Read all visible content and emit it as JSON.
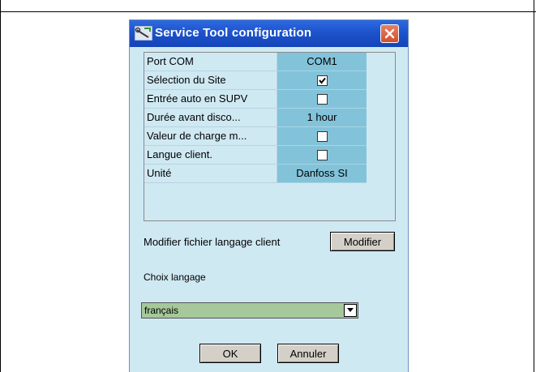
{
  "dialog": {
    "title": "Service Tool configuration",
    "title_icon": "wrench-tool-icon",
    "close_icon": "close-icon"
  },
  "settings": [
    {
      "name": "Port COM",
      "type": "text",
      "value": "COM1"
    },
    {
      "name": "Sélection du Site",
      "type": "checkbox",
      "checked": true
    },
    {
      "name": "Entrée auto en SUPV",
      "type": "checkbox",
      "checked": false
    },
    {
      "name": "Durée avant disco...",
      "type": "text",
      "value": "1 hour"
    },
    {
      "name": "Valeur de charge m...",
      "type": "checkbox",
      "checked": false
    },
    {
      "name": "Langue client.",
      "type": "checkbox",
      "checked": false
    },
    {
      "name": "Unité",
      "type": "text",
      "value": "Danfoss SI"
    }
  ],
  "modify": {
    "label": "Modifier fichier langage client",
    "button": "Modifier"
  },
  "language": {
    "label": "Choix langage",
    "selected": "français",
    "arrow_icon": "chevron-down-icon"
  },
  "buttons": {
    "ok": "OK",
    "cancel": "Annuler"
  },
  "colors": {
    "titlebar": "#1d53cc",
    "dialog_bg": "#cfe9f3",
    "value_cell": "#82c3da",
    "select_bg": "#a6c89a",
    "close_button": "#d24e2c"
  }
}
